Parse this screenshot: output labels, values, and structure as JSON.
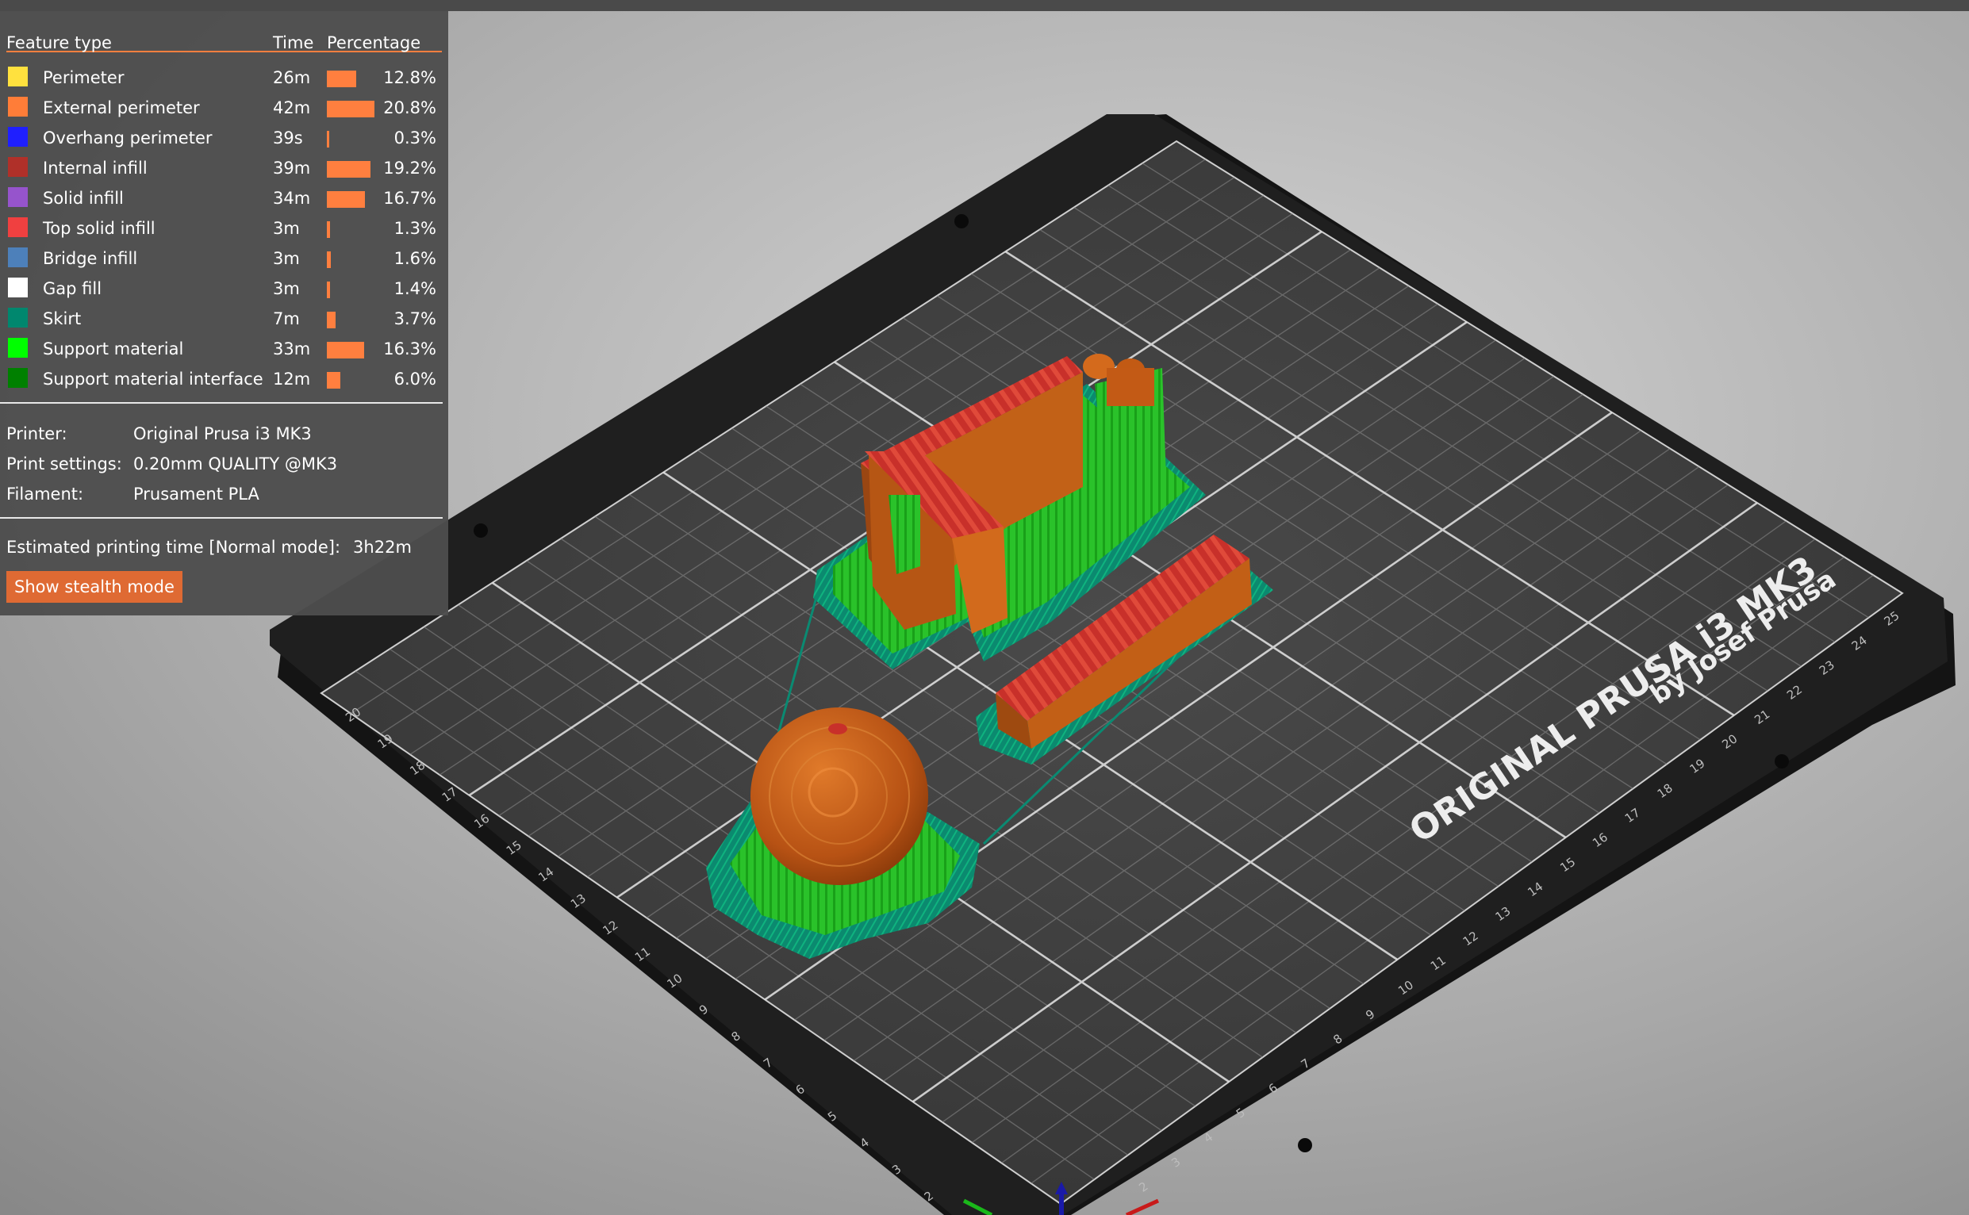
{
  "legend": {
    "headers": {
      "feature": "Feature type",
      "time": "Time",
      "percentage": "Percentage"
    },
    "items": [
      {
        "label": "Perimeter",
        "time": "26m",
        "percent": "12.8%",
        "fraction": 0.128,
        "color": "#ffe13e"
      },
      {
        "label": "External perimeter",
        "time": "42m",
        "percent": "20.8%",
        "fraction": 0.208,
        "color": "#ff7d38"
      },
      {
        "label": "Overhang perimeter",
        "time": "39s",
        "percent": "0.3%",
        "fraction": 0.003,
        "color": "#1f1fff"
      },
      {
        "label": "Internal infill",
        "time": "39m",
        "percent": "19.2%",
        "fraction": 0.192,
        "color": "#b03029"
      },
      {
        "label": "Solid infill",
        "time": "34m",
        "percent": "16.7%",
        "fraction": 0.167,
        "color": "#9654cc"
      },
      {
        "label": "Top solid infill",
        "time": "3m",
        "percent": "1.3%",
        "fraction": 0.013,
        "color": "#f04040"
      },
      {
        "label": "Bridge infill",
        "time": "3m",
        "percent": "1.6%",
        "fraction": 0.016,
        "color": "#4d80ba"
      },
      {
        "label": "Gap fill",
        "time": "3m",
        "percent": "1.4%",
        "fraction": 0.014,
        "color": "#ffffff"
      },
      {
        "label": "Skirt",
        "time": "7m",
        "percent": "3.7%",
        "fraction": 0.037,
        "color": "#00876e"
      },
      {
        "label": "Support material",
        "time": "33m",
        "percent": "16.3%",
        "fraction": 0.163,
        "color": "#00ff00"
      },
      {
        "label": "Support material interface",
        "time": "12m",
        "percent": "6.0%",
        "fraction": 0.06,
        "color": "#008000"
      }
    ],
    "bar_color": "#ff7f3f"
  },
  "info": [
    {
      "key": "Printer:",
      "value": "Original Prusa i3 MK3"
    },
    {
      "key": "Print settings:",
      "value": "0.20mm QUALITY @MK3"
    },
    {
      "key": "Filament:",
      "value": "Prusament PLA"
    }
  ],
  "estimate": {
    "label": "Estimated printing time [Normal mode]:",
    "value": "3h22m"
  },
  "stealth_button": {
    "label": "Show stealth mode"
  },
  "bed": {
    "brand": "ORIGINAL PRUSA i3 MK3",
    "byline": "by Josef Prusa",
    "left_scale": [
      "20",
      "19",
      "18",
      "17",
      "16",
      "15",
      "14",
      "13",
      "12",
      "11",
      "10",
      "9",
      "8",
      "7",
      "6",
      "5",
      "4",
      "3",
      "2"
    ],
    "bottom_scale": [
      "2",
      "3",
      "4",
      "5",
      "6",
      "7",
      "8",
      "9",
      "10",
      "11",
      "12",
      "13",
      "14",
      "15",
      "16",
      "17",
      "18",
      "19",
      "20",
      "21",
      "22",
      "23",
      "24",
      "25"
    ]
  },
  "colors": {
    "accent": "#ff7f3f",
    "panel_bg": "#4d4d4d",
    "bed_dark": "#1c1c1c",
    "bed_surface": "#3a3a3a",
    "model_orange": "#c85a14",
    "model_red": "#c8302a",
    "support_green": "#2ec82e",
    "skirt_teal": "#0a8a72"
  }
}
